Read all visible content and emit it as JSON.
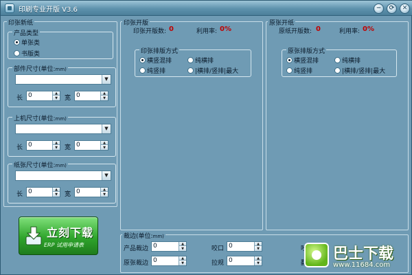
{
  "window": {
    "title": "印刷专业开版 V3.6",
    "buttons": [
      "−",
      "⟳",
      "✕"
    ]
  },
  "paper_panel": {
    "title": "印张新纸",
    "product_type": {
      "title": "产品类型",
      "options": [
        {
          "label": "单张类",
          "selected": true
        },
        {
          "label": "书版类",
          "selected": false
        }
      ]
    },
    "part_size": {
      "title": "部件尺寸(单位:",
      "unit": "mm)",
      "combo_value": "",
      "length_label": "长",
      "length_value": "0",
      "width_label": "宽",
      "width_value": "0"
    },
    "machine_size": {
      "title": "上机尺寸(单位:",
      "unit": "mm)",
      "combo_value": "",
      "length_label": "长",
      "length_value": "0",
      "width_label": "宽",
      "width_value": "0"
    },
    "sheet_size": {
      "title": "纸张尺寸(单位:",
      "unit": "mm)",
      "combo_value": "",
      "length_label": "长",
      "length_value": "0",
      "width_label": "宽",
      "width_value": "0"
    }
  },
  "download_button": {
    "main_label": "立刻下载",
    "sub_label": "ERP 试用申请表"
  },
  "print_cut_panel": {
    "title": "印张开版",
    "count_label": "印张开版数:",
    "count_value": "0",
    "rate_label": "利用率:",
    "rate_value": "0%",
    "layout_group": {
      "title": "印张排版方式",
      "options": [
        {
          "label": "横竖混排",
          "selected": true
        },
        {
          "label": "纯横排",
          "selected": false
        },
        {
          "label": "纯竖排",
          "selected": false
        },
        {
          "label": "|横排/竖排|最大",
          "selected": false
        }
      ]
    }
  },
  "raw_sheet_panel": {
    "title": "原张开纸",
    "count_label": "原纸开版数:",
    "count_value": "0",
    "rate_label": "利用率:",
    "rate_value": "0%",
    "layout_group": {
      "title": "原张排版方式",
      "options": [
        {
          "label": "横竖混排",
          "selected": true
        },
        {
          "label": "纯横排",
          "selected": false
        },
        {
          "label": "纯竖排",
          "selected": false
        },
        {
          "label": "|横排/竖排|最大",
          "selected": false
        }
      ]
    }
  },
  "trim_panel": {
    "title": "裁边(单位:",
    "unit": "mm)",
    "product_trim_label": "产品裁边",
    "product_trim_value": "0",
    "bite_label": "咬口",
    "bite_value": "0",
    "sheet_trim_label": "原张裁边",
    "sheet_trim_value": "0",
    "pull_label": "拉规",
    "pull_value": "0",
    "extra_label_1": "咬口",
    "extra_label_2": "翻"
  },
  "watermark": {
    "title": "巴士下载",
    "url": "www.11684.com"
  }
}
